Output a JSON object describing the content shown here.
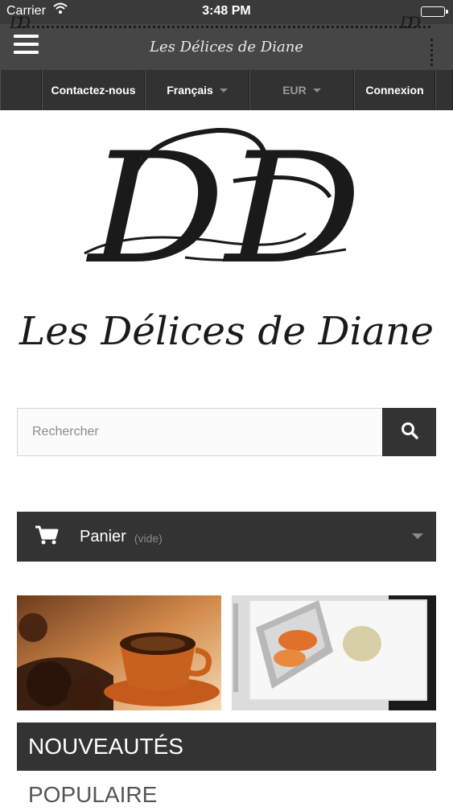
{
  "status_bar": {
    "carrier": "Carrier",
    "time": "3:48 PM"
  },
  "header": {
    "title": "Les Délices de Diane",
    "monogram": "DD"
  },
  "top_nav": {
    "contact": "Contactez-nous",
    "language": "Français",
    "currency": "EUR",
    "login": "Connexion"
  },
  "logo": {
    "monogram": "DD",
    "name": "Les Délices de Diane"
  },
  "search": {
    "placeholder": "Rechercher"
  },
  "cart": {
    "label": "Panier",
    "status": "(vide)"
  },
  "tabs": {
    "new": "NOUVEAUTÉS",
    "popular": "POPULAIRE"
  },
  "icons": {
    "menu": "hamburger-icon",
    "search": "search-icon",
    "cart": "cart-icon",
    "wifi": "wifi-icon",
    "battery": "battery-icon"
  },
  "colors": {
    "dark": "#333333",
    "nav_bar": "#464646",
    "status_bar": "#3a3a3a",
    "muted": "#8a8a8a"
  }
}
